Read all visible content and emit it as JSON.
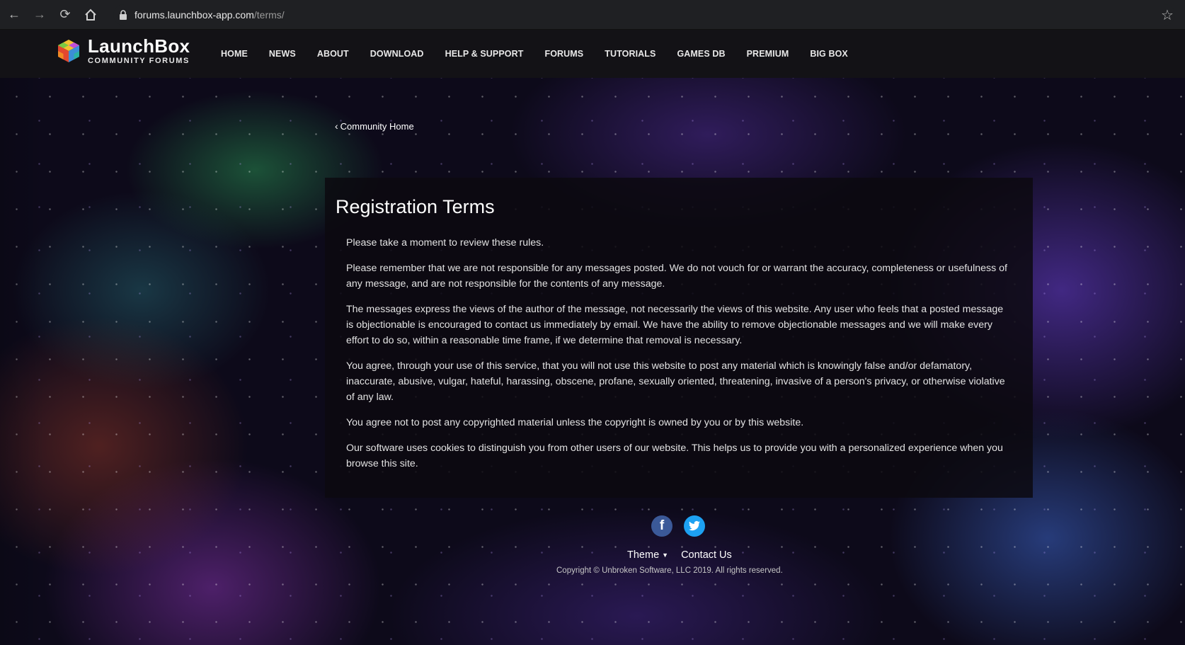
{
  "browser": {
    "url_host": "forums.launchbox-app.com",
    "url_path": "/terms/"
  },
  "header": {
    "logo_title": "LaunchBox",
    "logo_subtitle": "COMMUNITY FORUMS",
    "nav": [
      "HOME",
      "NEWS",
      "ABOUT",
      "DOWNLOAD",
      "HELP & SUPPORT",
      "FORUMS",
      "TUTORIALS",
      "GAMES DB",
      "PREMIUM",
      "BIG BOX"
    ]
  },
  "breadcrumb": {
    "chevron": "‹",
    "label": "Community Home"
  },
  "terms": {
    "title": "Registration Terms",
    "paragraphs": [
      "Please take a moment to review these rules.",
      "Please remember that we are not responsible for any messages posted. We do not vouch for or warrant the accuracy, completeness or usefulness of any message, and are not responsible for the contents of any message.",
      "The messages express the views of the author of the message, not necessarily the views of this website. Any user who feels that a posted message is objectionable is encouraged to contact us immediately by email. We have the ability to remove objectionable messages and we will make every effort to do so, within a reasonable time frame, if we determine that removal is necessary.",
      "You agree, through your use of this service, that you will not use this website to post any material which is knowingly false and/or defamatory, inaccurate, abusive, vulgar, hateful, harassing, obscene, profane, sexually oriented, threatening, invasive of a person's privacy, or otherwise violative of any law.",
      "You agree not to post any copyrighted material unless the copyright is owned by you or by this website.",
      "Our software uses cookies to distinguish you from other users of our website. This helps us to provide you with a personalized experience when you browse this site."
    ]
  },
  "footer": {
    "theme_label": "Theme",
    "contact_label": "Contact Us",
    "copyright": "Copyright © Unbroken Software, LLC 2019. All rights reserved."
  },
  "icons": {
    "back": "back-arrow-icon",
    "forward": "forward-arrow-icon",
    "reload": "reload-icon",
    "home": "home-icon",
    "lock": "lock-icon",
    "star": "star-icon",
    "facebook": "facebook-icon",
    "twitter": "twitter-icon"
  },
  "colors": {
    "header_bg": "#131216",
    "panel_bg": "#0c0a10",
    "facebook": "#3b5998",
    "twitter": "#1da1f2"
  }
}
